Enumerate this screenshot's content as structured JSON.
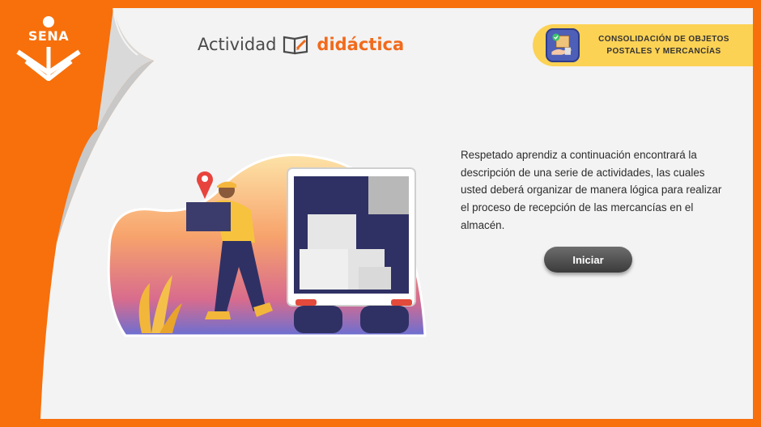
{
  "brand": {
    "logo_text": "SENA"
  },
  "header": {
    "title_part1": "Actividad",
    "title_part2": "didáctica",
    "book_icon": "book-pencil-icon"
  },
  "badge": {
    "icon": "package-hand-icon",
    "line1": "CONSOLIDACIÓN DE OBJETOS",
    "line2": "POSTALES Y MERCANCÍAS"
  },
  "main": {
    "description": "Respetado aprendiz a continuación encontrará la descripción de una serie de actividades, las cuales usted deberá organizar de manera lógica para realizar el proceso de recepción de las mercancías en el almacén.",
    "start_button": "Iniciar"
  },
  "colors": {
    "orange": "#f7700c",
    "paper": "#f3f3f3",
    "badge_yellow": "#fcd255",
    "title_orange": "#f26a1b",
    "button_dark": "#4a4a4a"
  }
}
